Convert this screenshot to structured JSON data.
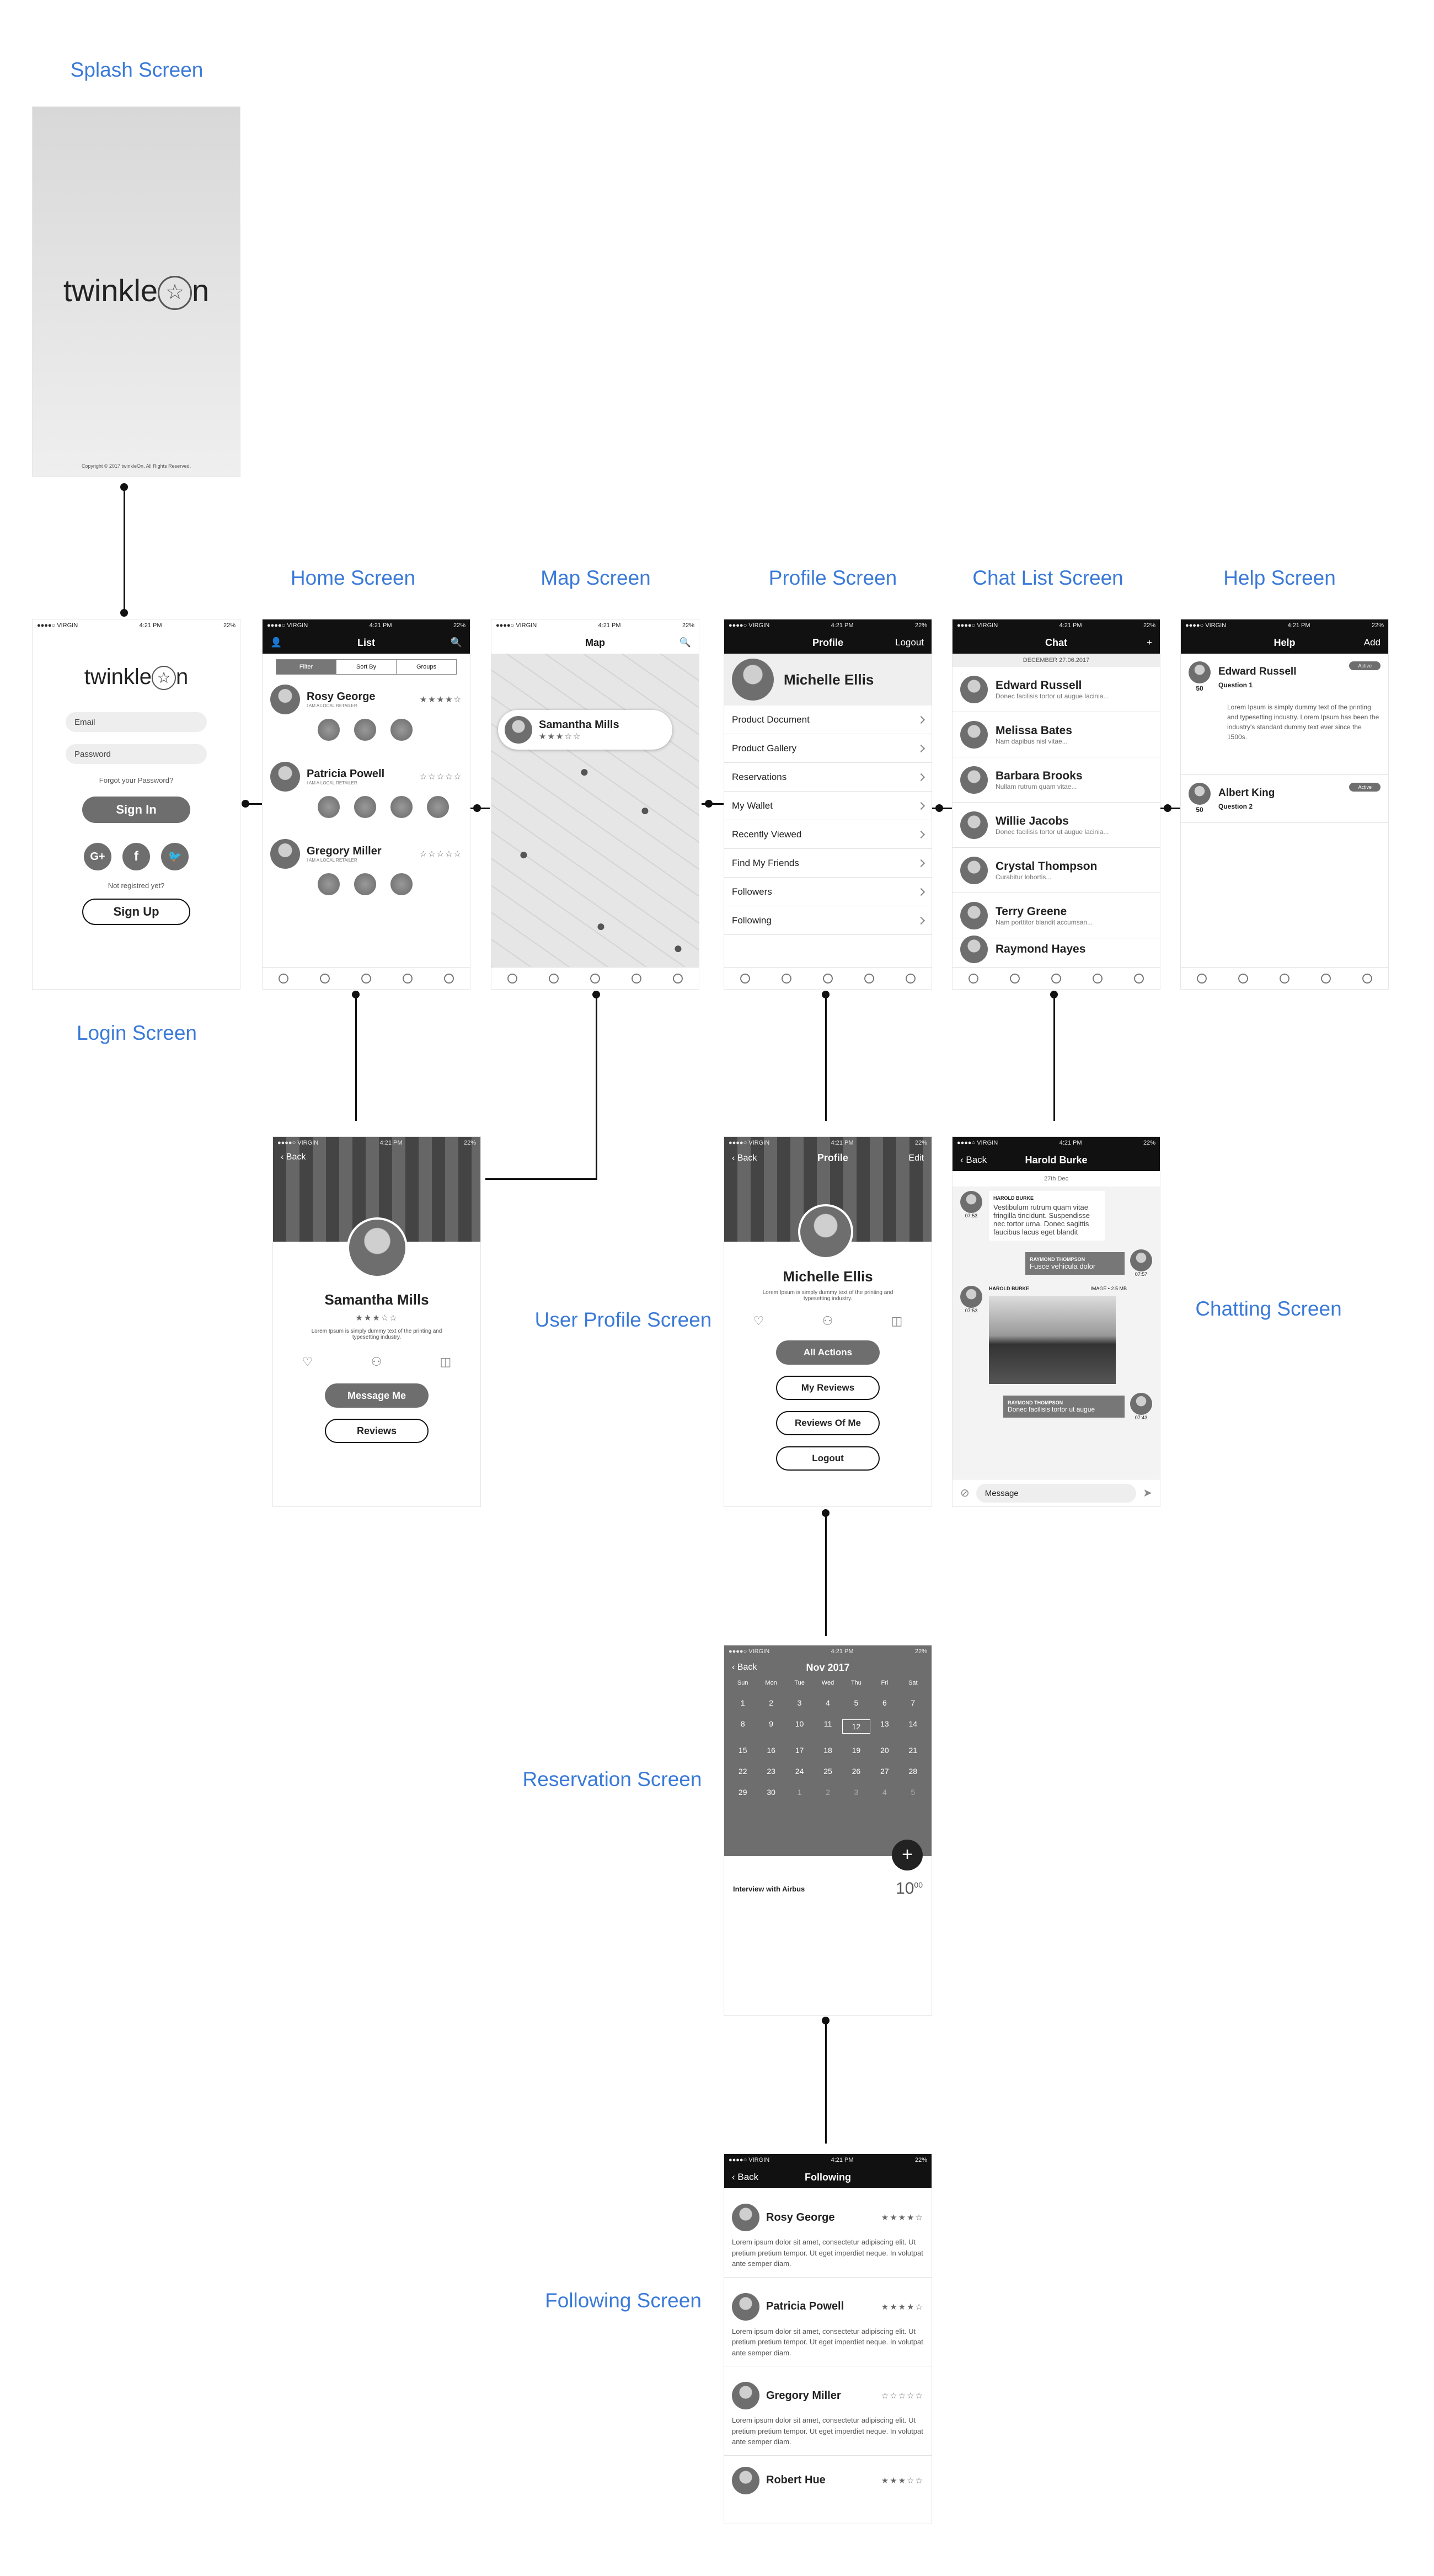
{
  "labels": {
    "splash": "Splash Screen",
    "login": "Login Screen",
    "home": "Home Screen",
    "map": "Map Screen",
    "profile": "Profile Screen",
    "chatlist": "Chat List Screen",
    "help": "Help Screen",
    "userprofile": "User Profile Screen",
    "chatting": "Chatting Screen",
    "reservation": "Reservation Screen",
    "following": "Following Screen"
  },
  "status": {
    "carrier": "●●●●○ VIRGIN",
    "time": "4:21 PM",
    "battery": "22%"
  },
  "splash": {
    "logo": "twinkle",
    "logo_suffix": "n",
    "copyright": "Copyright © 2017 twinkleOn. All Rights Reserved."
  },
  "login": {
    "logo": "twinkle",
    "logo_suffix": "n",
    "email_ph": "Email",
    "password_ph": "Password",
    "forgot": "Forgot your Password?",
    "signin": "Sign In",
    "not_registered": "Not registred yet?",
    "signup": "Sign Up"
  },
  "home": {
    "title": "List",
    "seg": [
      "Filter",
      "Sort By",
      "Groups"
    ],
    "people": [
      {
        "name": "Rosy George",
        "sub": "I AM A LOCAL RETAILER",
        "stars": "★★★★☆"
      },
      {
        "name": "Patricia Powell",
        "sub": "I AM A LOCAL RETAILER",
        "stars": "☆☆☆☆☆"
      },
      {
        "name": "Gregory Miller",
        "sub": "I AM A LOCAL RETAILER",
        "stars": "☆☆☆☆☆"
      }
    ]
  },
  "map": {
    "title": "Map",
    "card_name": "Samantha Mills",
    "card_stars": "★★★☆☆"
  },
  "profile": {
    "title": "Profile",
    "logout": "Logout",
    "name": "Michelle Ellis",
    "items": [
      "Product Document",
      "Product Gallery",
      "Reservations",
      "My Wallet",
      "Recently Viewed",
      "Find My Friends",
      "Followers",
      "Following"
    ]
  },
  "chatlist": {
    "title": "Chat",
    "date": "DECEMBER 27.06.2017",
    "chats": [
      {
        "name": "Edward Russell",
        "msg": "Donec facilisis tortor ut augue lacinia..."
      },
      {
        "name": "Melissa Bates",
        "msg": "Nam dapibus nisl vitae..."
      },
      {
        "name": "Barbara Brooks",
        "msg": "Nullam rutrum quam vitae..."
      },
      {
        "name": "Willie Jacobs",
        "msg": "Donec facilisis tortor ut augue lacinia..."
      },
      {
        "name": "Crystal Thompson",
        "msg": "Curabitur lobortis..."
      },
      {
        "name": "Terry Greene",
        "msg": "Nam porttitor blandit accumsan..."
      },
      {
        "name": "Raymond Hayes",
        "msg": ""
      }
    ]
  },
  "help": {
    "title": "Help",
    "add": "Add",
    "entries": [
      {
        "name": "Edward Russell",
        "q": "Question 1",
        "num": "50",
        "badge": "Active",
        "body": "Lorem Ipsum is simply dummy text of the printing and typesetting industry. Lorem Ipsum has been the industry's standard dummy text ever since the 1500s."
      },
      {
        "name": "Albert King",
        "q": "Question 2",
        "num": "50",
        "badge": "Active",
        "body": ""
      }
    ]
  },
  "userprofile": {
    "back": "Back",
    "name": "Samantha Mills",
    "stars": "★★★☆☆",
    "desc": "Lorem Ipsum is simply dummy text of the printing and typesetting industry.",
    "message": "Message Me",
    "reviews": "Reviews"
  },
  "myprofile": {
    "back": "Back",
    "title": "Profile",
    "edit": "Edit",
    "name": "Michelle Ellis",
    "desc": "Lorem Ipsum is simply dummy text of the printing and typesetting industry.",
    "actions": [
      "All Actions",
      "My Reviews",
      "Reviews Of Me",
      "Logout"
    ]
  },
  "chatting": {
    "back": "Back",
    "title": "Harold Burke",
    "date": "27th Dec",
    "m1_name": "HAROLD BURKE",
    "m1_time": "07:53",
    "m1_text": "Vestibulum rutrum quam vitae fringilla tincidunt. Suspendisse nec tortor urna. Donec sagittis faucibus lacus eget blandit",
    "m2_name": "RAYMOND THOMPSON",
    "m2_text": "Fusce vehicula dolor",
    "m2_time": "07:57",
    "m3_name": "HAROLD BURKE",
    "m3_meta": "IMAGE • 2.5 MB",
    "m3_time": "07:53",
    "m4_name": "RAYMOND THOMPSON",
    "m4_text": "Donec facilisis tortor ut augue",
    "m4_time": "07:43",
    "input_ph": "Message"
  },
  "reservation": {
    "back": "Back",
    "month": "Nov 2017",
    "weekdays": [
      "Sun",
      "Mon",
      "Tue",
      "Wed",
      "Thu",
      "Fri",
      "Sat"
    ],
    "days": [
      "1",
      "2",
      "3",
      "4",
      "5",
      "6",
      "7",
      "8",
      "9",
      "10",
      "11",
      "12",
      "13",
      "14",
      "15",
      "16",
      "17",
      "18",
      "19",
      "20",
      "21",
      "22",
      "23",
      "24",
      "25",
      "26",
      "27",
      "28",
      "29",
      "30",
      "1",
      "2",
      "3",
      "4",
      "5"
    ],
    "event": "Interview with Airbus",
    "event_time": "10",
    "event_min": "00"
  },
  "following": {
    "back": "Back",
    "title": "Following",
    "people": [
      {
        "name": "Rosy George",
        "stars": "★★★★☆",
        "text": "Lorem ipsum dolor sit amet, consectetur adipiscing elit. Ut pretium pretium tempor. Ut eget imperdiet neque. In volutpat ante semper diam."
      },
      {
        "name": "Patricia Powell",
        "stars": "★★★★☆",
        "text": "Lorem ipsum dolor sit amet, consectetur adipiscing elit. Ut pretium pretium tempor. Ut eget imperdiet neque. In volutpat ante semper diam."
      },
      {
        "name": "Gregory Miller",
        "stars": "☆☆☆☆☆",
        "text": "Lorem ipsum dolor sit amet, consectetur adipiscing elit. Ut pretium pretium tempor. Ut eget imperdiet neque. In volutpat ante semper diam."
      },
      {
        "name": "Robert Hue",
        "stars": "★★★☆☆",
        "text": ""
      }
    ]
  },
  "colors": {
    "label": "#3a7ad8",
    "dark": "#111111",
    "gray": "#6e6e6e"
  }
}
